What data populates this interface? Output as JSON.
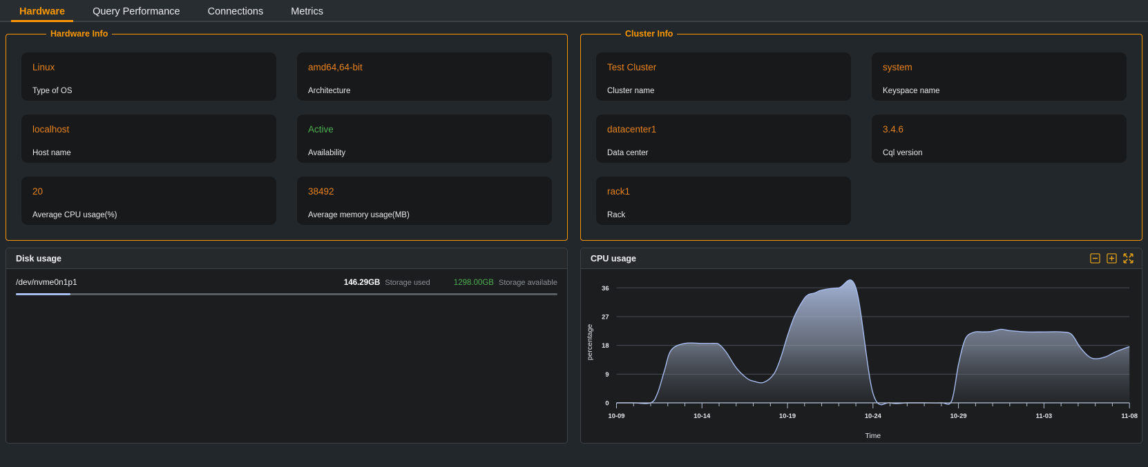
{
  "tabs": [
    {
      "label": "Hardware",
      "active": true
    },
    {
      "label": "Query Performance",
      "active": false
    },
    {
      "label": "Connections",
      "active": false
    },
    {
      "label": "Metrics",
      "active": false
    }
  ],
  "hardware_info": {
    "legend": "Hardware Info",
    "cards": [
      {
        "value": "Linux",
        "label": "Type of OS",
        "color": "orange"
      },
      {
        "value": "amd64,64-bit",
        "label": "Architecture",
        "color": "orange"
      },
      {
        "value": "localhost",
        "label": "Host name",
        "color": "orange"
      },
      {
        "value": "Active",
        "label": "Availability",
        "color": "green"
      },
      {
        "value": "20",
        "label": "Average CPU usage(%)",
        "color": "orange"
      },
      {
        "value": "38492",
        "label": "Average memory usage(MB)",
        "color": "orange"
      }
    ]
  },
  "cluster_info": {
    "legend": "Cluster Info",
    "cards": [
      {
        "value": "Test Cluster",
        "label": "Cluster name",
        "color": "orange"
      },
      {
        "value": "system",
        "label": "Keyspace name",
        "color": "orange"
      },
      {
        "value": "datacenter1",
        "label": "Data center",
        "color": "orange"
      },
      {
        "value": "3.4.6",
        "label": "Cql version",
        "color": "orange"
      },
      {
        "value": "rack1",
        "label": "Rack",
        "color": "orange"
      },
      {
        "value": "",
        "label": "",
        "color": "none"
      }
    ]
  },
  "disk_panel": {
    "title": "Disk usage",
    "device": "/dev/nvme0n1p1",
    "used_value": "146.29GB",
    "used_caption": "Storage used",
    "available_value": "1298.00GB",
    "available_caption": "Storage available",
    "used_percent": 10.1
  },
  "cpu_panel": {
    "title": "CPU usage",
    "tools": [
      {
        "name": "zoom-out-icon",
        "glyph": "minus-box"
      },
      {
        "name": "zoom-in-icon",
        "glyph": "plus-box"
      },
      {
        "name": "collapse-icon",
        "glyph": "compress-arrows"
      }
    ]
  },
  "colors": {
    "accent": "#ff9800",
    "value_orange": "#e8821e",
    "value_green": "#4caf50",
    "chart_line": "#a8bdf0",
    "panel_bg": "#1b1d1f",
    "card_bg": "#17191a"
  },
  "chart_data": {
    "type": "area",
    "title": "CPU usage",
    "xlabel": "Time",
    "ylabel": "percentage",
    "ylim": [
      0,
      38
    ],
    "yticks": [
      0,
      9,
      18,
      27,
      36
    ],
    "ytick_labels": [
      "0",
      "9",
      "18",
      "27",
      "36"
    ],
    "xtick_labels": [
      "10-09",
      "10-14",
      "10-19",
      "10-24",
      "10-29",
      "11-03",
      "11-08"
    ],
    "xlim": [
      "10-09",
      "11-08"
    ],
    "grid": true,
    "legend": "none",
    "x": [
      0,
      1,
      2,
      2.4,
      2.8,
      3.2,
      4,
      5,
      5.4,
      5.8,
      6,
      6.4,
      7,
      7.6,
      8,
      8.6,
      9.2,
      9.6,
      10,
      10.4,
      10.9,
      11.2,
      11.6,
      12,
      13,
      14,
      15,
      16,
      17,
      18,
      19,
      19.6,
      20,
      20.4,
      20.9,
      21.4,
      21.9,
      22.5,
      23,
      24,
      25,
      26,
      26.6,
      27.1,
      27.6,
      28,
      28.6,
      29.2,
      30
    ],
    "values": [
      0,
      0,
      0,
      3,
      10,
      16.5,
      18.6,
      18.6,
      18.6,
      18.6,
      18.3,
      16,
      11,
      7.8,
      6.8,
      6.4,
      9,
      14,
      21,
      27,
      32,
      33.8,
      34.4,
      35.3,
      36,
      36,
      3,
      0,
      0,
      0,
      0,
      0.6,
      12,
      20,
      22.1,
      22.2,
      22.3,
      23,
      22.6,
      22.2,
      22.2,
      22.2,
      21.5,
      17.5,
      14.6,
      13.8,
      14.4,
      16,
      17.6
    ],
    "area_fill": "vertical gradient from #a8bdf0 (top) to transparent (bottom)"
  }
}
